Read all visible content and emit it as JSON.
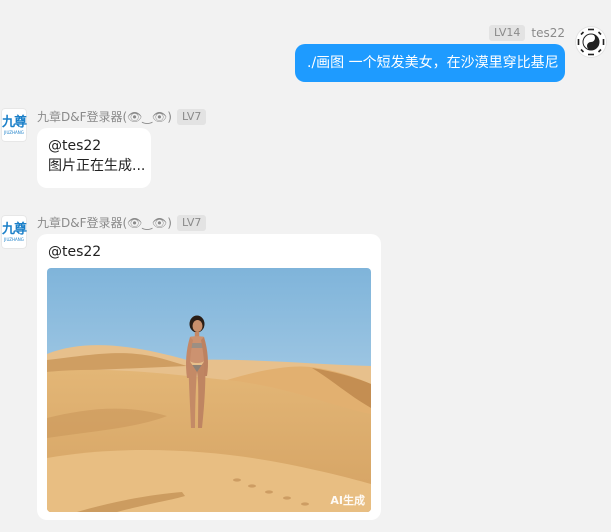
{
  "user_message": {
    "level": "LV14",
    "username": "tes22",
    "text": "./画图 一个短发美女，在沙漠里穿比基尼"
  },
  "bot": {
    "name": "九章D&F登录器(👁‿👁)",
    "level": "LV7",
    "logo_text": "九尊",
    "logo_caption": "JIUZHANG"
  },
  "bot_message_1": {
    "mention": "@tes22",
    "status": "图片正在生成..."
  },
  "bot_message_2": {
    "mention": "@tes22",
    "image_badge": "AI生成"
  },
  "colors": {
    "user_bubble": "#1e9bff",
    "background": "#f2f2f2"
  },
  "icons": {
    "user_avatar": "yin-yang-bagua-icon",
    "bot_avatar": "jiuzhang-logo"
  }
}
